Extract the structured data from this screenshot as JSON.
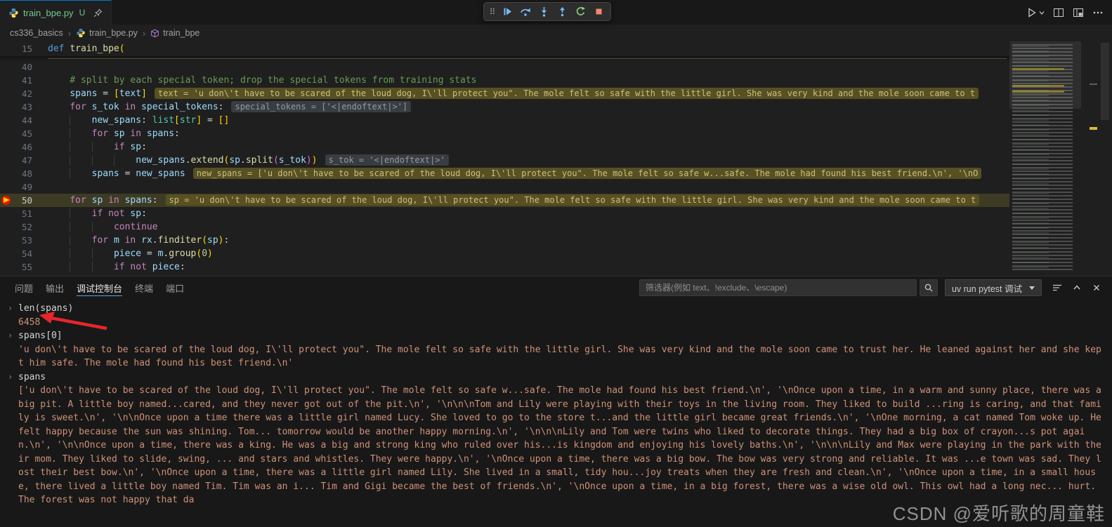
{
  "colors": {
    "accent": "#0078d4",
    "git_untracked": "#73c991",
    "string_orange": "#ce9178",
    "debug_current_line": "#575023",
    "annotation_arrow": "#e8252c"
  },
  "tab": {
    "label": "train_bpe.py",
    "git_status": "U"
  },
  "breadcrumb": {
    "items": [
      {
        "label": "cs336_basics",
        "icon": null
      },
      {
        "label": "train_bpe.py",
        "icon": "python"
      },
      {
        "label": "train_bpe",
        "icon": "symbol"
      }
    ]
  },
  "debug_toolbar": {
    "buttons": [
      {
        "key": "continue"
      },
      {
        "key": "step-over"
      },
      {
        "key": "step-into"
      },
      {
        "key": "step-out"
      },
      {
        "key": "restart"
      },
      {
        "key": "stop"
      }
    ]
  },
  "editor": {
    "sticky": {
      "num": "15",
      "indent": 0,
      "tokens": [
        {
          "t": "def ",
          "c": "kw"
        },
        {
          "t": "train_bpe",
          "c": "fn"
        },
        {
          "t": "(",
          "c": "br"
        }
      ]
    },
    "lines": [
      {
        "num": "40",
        "indent": 0,
        "tokens": []
      },
      {
        "num": "41",
        "indent": 1,
        "tokens": [
          {
            "t": "# split by each special token; drop the special tokens from training stats",
            "c": "cm"
          }
        ]
      },
      {
        "num": "42",
        "indent": 1,
        "tokens": [
          {
            "t": "spans",
            "c": "var"
          },
          {
            "t": " = ",
            "c": "pn"
          },
          {
            "t": "[",
            "c": "br"
          },
          {
            "t": "text",
            "c": "var"
          },
          {
            "t": "]",
            "c": "br"
          }
        ],
        "hint": {
          "text": "text = 'u don\\'t have to be scared of the loud dog, I\\'ll protect you\". The mole felt so safe with the little girl. She was very kind and the mole soon came to t",
          "hl": true
        }
      },
      {
        "num": "43",
        "indent": 1,
        "tokens": [
          {
            "t": "for ",
            "c": "ctrl"
          },
          {
            "t": "s_tok",
            "c": "var"
          },
          {
            "t": " in ",
            "c": "ctrl"
          },
          {
            "t": "special_tokens",
            "c": "var"
          },
          {
            "t": ":",
            "c": "pn"
          }
        ],
        "hint": {
          "text": "special_tokens = ['<|endoftext|>']",
          "hl": false
        }
      },
      {
        "num": "44",
        "indent": 2,
        "tokens": [
          {
            "t": "new_spans",
            "c": "var"
          },
          {
            "t": ": ",
            "c": "pn"
          },
          {
            "t": "list",
            "c": "type"
          },
          {
            "t": "[",
            "c": "br"
          },
          {
            "t": "str",
            "c": "type"
          },
          {
            "t": "]",
            "c": "br"
          },
          {
            "t": " = ",
            "c": "pn"
          },
          {
            "t": "[]",
            "c": "br"
          }
        ]
      },
      {
        "num": "45",
        "indent": 2,
        "tokens": [
          {
            "t": "for ",
            "c": "ctrl"
          },
          {
            "t": "sp",
            "c": "var"
          },
          {
            "t": " in ",
            "c": "ctrl"
          },
          {
            "t": "spans",
            "c": "var"
          },
          {
            "t": ":",
            "c": "pn"
          }
        ]
      },
      {
        "num": "46",
        "indent": 3,
        "tokens": [
          {
            "t": "if ",
            "c": "ctrl"
          },
          {
            "t": "sp",
            "c": "var"
          },
          {
            "t": ":",
            "c": "pn"
          }
        ]
      },
      {
        "num": "47",
        "indent": 4,
        "tokens": [
          {
            "t": "new_spans",
            "c": "var"
          },
          {
            "t": ".",
            "c": "pn"
          },
          {
            "t": "extend",
            "c": "fn"
          },
          {
            "t": "(",
            "c": "br"
          },
          {
            "t": "sp",
            "c": "var"
          },
          {
            "t": ".",
            "c": "pn"
          },
          {
            "t": "split",
            "c": "fn"
          },
          {
            "t": "(",
            "c": "br2"
          },
          {
            "t": "s_tok",
            "c": "var"
          },
          {
            "t": ")",
            "c": "br2"
          },
          {
            "t": ")",
            "c": "br"
          }
        ],
        "hint": {
          "text": "s_tok = '<|endoftext|>'",
          "hl": false
        }
      },
      {
        "num": "48",
        "indent": 2,
        "tokens": [
          {
            "t": "spans",
            "c": "var"
          },
          {
            "t": " = ",
            "c": "pn"
          },
          {
            "t": "new_spans",
            "c": "var"
          }
        ],
        "hint": {
          "text": "new_spans = ['u don\\'t have to be scared of the loud dog, I\\'ll protect you\". The mole felt so safe w...safe. The mole had found his best friend.\\n', '\\nO",
          "hl": true
        }
      },
      {
        "num": "49",
        "indent": 0,
        "tokens": []
      },
      {
        "num": "50",
        "indent": 1,
        "current": true,
        "tokens": [
          {
            "t": "for ",
            "c": "ctrl"
          },
          {
            "t": "sp",
            "c": "var"
          },
          {
            "t": " in ",
            "c": "ctrl"
          },
          {
            "t": "spans",
            "c": "var"
          },
          {
            "t": ":",
            "c": "pn"
          }
        ],
        "hint": {
          "text": "sp = 'u don\\'t have to be scared of the loud dog, I\\'ll protect you\". The mole felt so safe with the little girl. She was very kind and the mole soon came to t",
          "hl": true
        }
      },
      {
        "num": "51",
        "indent": 2,
        "tokens": [
          {
            "t": "if ",
            "c": "ctrl"
          },
          {
            "t": "not ",
            "c": "ctrl"
          },
          {
            "t": "sp",
            "c": "var"
          },
          {
            "t": ":",
            "c": "pn"
          }
        ]
      },
      {
        "num": "52",
        "indent": 3,
        "tokens": [
          {
            "t": "continue",
            "c": "ctrl"
          }
        ]
      },
      {
        "num": "53",
        "indent": 2,
        "tokens": [
          {
            "t": "for ",
            "c": "ctrl"
          },
          {
            "t": "m",
            "c": "var"
          },
          {
            "t": " in ",
            "c": "ctrl"
          },
          {
            "t": "rx",
            "c": "var"
          },
          {
            "t": ".",
            "c": "pn"
          },
          {
            "t": "finditer",
            "c": "fn"
          },
          {
            "t": "(",
            "c": "br"
          },
          {
            "t": "sp",
            "c": "var"
          },
          {
            "t": ")",
            "c": "br"
          },
          {
            "t": ":",
            "c": "pn"
          }
        ]
      },
      {
        "num": "54",
        "indent": 3,
        "tokens": [
          {
            "t": "piece",
            "c": "var"
          },
          {
            "t": " = ",
            "c": "pn"
          },
          {
            "t": "m",
            "c": "var"
          },
          {
            "t": ".",
            "c": "pn"
          },
          {
            "t": "group",
            "c": "fn"
          },
          {
            "t": "(",
            "c": "br"
          },
          {
            "t": "0",
            "c": "num"
          },
          {
            "t": ")",
            "c": "br"
          }
        ]
      },
      {
        "num": "55",
        "indent": 3,
        "tokens": [
          {
            "t": "if ",
            "c": "ctrl"
          },
          {
            "t": "not ",
            "c": "ctrl"
          },
          {
            "t": "piece",
            "c": "var"
          },
          {
            "t": ":",
            "c": "pn"
          }
        ]
      }
    ]
  },
  "panel": {
    "tabs": [
      {
        "key": "problems",
        "label": "问题"
      },
      {
        "key": "output",
        "label": "输出"
      },
      {
        "key": "debug-console",
        "label": "调试控制台",
        "active": true
      },
      {
        "key": "terminal",
        "label": "终端"
      },
      {
        "key": "ports",
        "label": "端口"
      }
    ],
    "filter_placeholder": "筛选器(例如 text、!exclude、\\escape)",
    "launch_config": "uv run pytest 调试"
  },
  "console": {
    "entries": [
      {
        "kind": "input",
        "text": "len(spans)"
      },
      {
        "kind": "output",
        "text": "6458"
      },
      {
        "kind": "input",
        "text": "spans[0]"
      },
      {
        "kind": "output",
        "text": "'u don\\'t have to be scared of the loud dog, I\\'ll protect you\". The mole felt so safe with the little girl. She was very kind and the mole soon came to trust her. He leaned against her and she kept him safe. The mole had found his best friend.\\n'"
      },
      {
        "kind": "input",
        "text": "spans"
      },
      {
        "kind": "output",
        "text": "['u don\\'t have to be scared of the loud dog, I\\'ll protect you\". The mole felt so safe w...safe. The mole had found his best friend.\\n', '\\nOnce upon a time, in a warm and sunny place, there was a big pit. A little boy named...cared, and they never got out of the pit.\\n', '\\n\\n\\nTom and Lily were playing with their toys in the living room. They liked to build ...ring is caring, and that family is sweet.\\n', '\\n\\nOnce upon a time there was a little girl named Lucy. She loved to go to the store t...and the little girl became great friends.\\n', '\\nOne morning, a cat named Tom woke up. He felt happy because the sun was shining. Tom... tomorrow would be another happy morning.\\n', '\\n\\n\\nLily and Tom were twins who liked to decorate things. They had a big box of crayon...s pot again.\\n', '\\n\\nOnce upon a time, there was a king. He was a big and strong king who ruled over his...is kingdom and enjoying his lovely baths.\\n', '\\n\\n\\nLily and Max were playing in the park with their mom. They liked to slide, swing, ... and stars and whistles. They were happy.\\n', '\\nOnce upon a time, there was a big bow. The bow was very strong and reliable. It was ...e town was sad. They lost their best bow.\\n', '\\nOnce upon a time, there was a little girl named Lily. She lived in a small, tidy hou...joy treats when they are fresh and clean.\\n', '\\nOnce upon a time, in a small house, there lived a little boy named Tim. Tim was an i... Tim and Gigi became the best of friends.\\n', '\\nOnce upon a time, in a big forest, there was a wise old owl. This owl had a long nec... hurt. The forest was not happy that da"
      }
    ]
  },
  "watermark": "CSDN @爱听歌的周童鞋"
}
